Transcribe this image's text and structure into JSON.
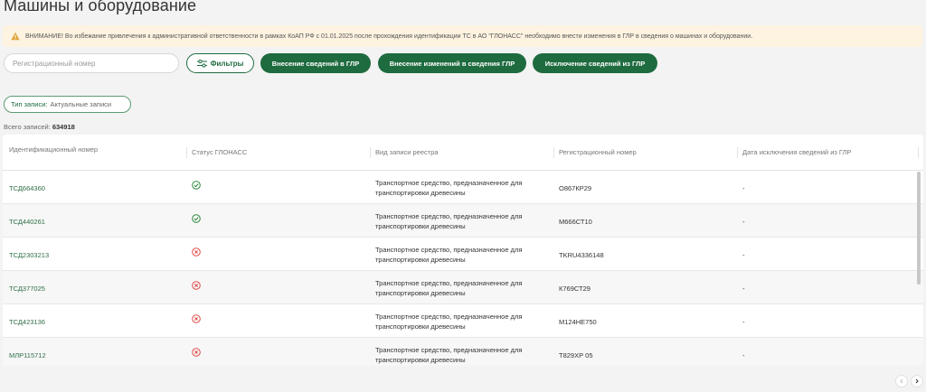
{
  "page": {
    "title": "Машины и оборудование"
  },
  "warning": {
    "text": "ВНИМАНИЕ! Во избежание привлечения к административной ответственности в рамках КоАП РФ с 01.01.2025 после прохождения идентификации ТС в АО \"ГЛОНАСС\" необходимо внести изменения в ГЛР в сведения о машинах и оборудовании.",
    "icon": "warning-triangle-icon",
    "color": "#e0a43a"
  },
  "toolbar": {
    "search_placeholder": "Регистрационный номер",
    "search_value": "",
    "filters_label": "Фильтры",
    "add_label": "Внесение сведений в ГЛР",
    "change_label": "Внесение изменений в сведения ГЛР",
    "exclude_label": "Исключение сведений из ГЛР"
  },
  "filter_chip": {
    "key": "Тип записи:",
    "value": "Актуальные записи"
  },
  "summary": {
    "label": "Всего записей:",
    "count": "634918"
  },
  "table": {
    "columns": [
      "Идентификационный номер",
      "Статус ГЛОНАСС",
      "Вид записи реестра",
      "Регистрационный номер",
      "Дата исключения сведений из ГЛР"
    ],
    "rows": [
      {
        "id": "ТСД664360",
        "status": "ok",
        "kind": "Транспортное средство, предназначенное для транспортировки древесины",
        "reg": "О867КР29",
        "date": "-"
      },
      {
        "id": "ТСД440261",
        "status": "ok",
        "kind": "Транспортное средство, предназначенное для транспортировки древесины",
        "reg": "М666СТ10",
        "date": "-"
      },
      {
        "id": "ТСД2303213",
        "status": "error",
        "kind": "Транспортное средство, предназначенное для транспортировки древесины",
        "reg": "TKRU4336148",
        "date": "-"
      },
      {
        "id": "ТСД377025",
        "status": "error",
        "kind": "Транспортное средство, предназначенное для транспортировки древесины",
        "reg": "К769СТ29",
        "date": "-"
      },
      {
        "id": "ТСД423136",
        "status": "error",
        "kind": "Транспортное средство, предназначенное для транспортировки древесины",
        "reg": "М124НЕ750",
        "date": "-"
      },
      {
        "id": "МЛР115712",
        "status": "error",
        "kind": "Транспортное средство, предназначенное для транспортировки древесины",
        "reg": "Т829ХР 05",
        "date": "-"
      }
    ]
  },
  "colors": {
    "accent": "#1e6b3f",
    "ok": "#2e8b3e",
    "error": "#e04c4c",
    "link": "#2f6f48"
  }
}
